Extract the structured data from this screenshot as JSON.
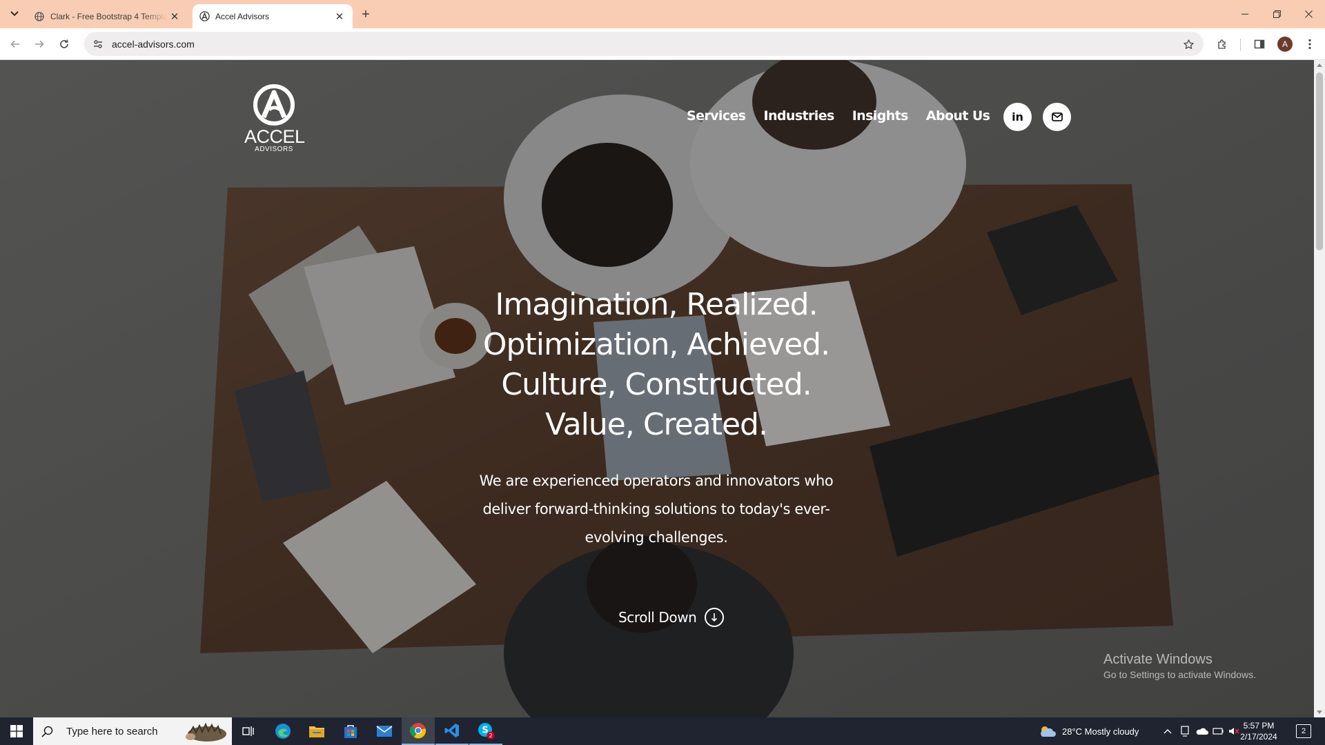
{
  "browser": {
    "tabs": [
      {
        "title": "Clark - Free Bootstrap 4 Template",
        "active": false
      },
      {
        "title": "Accel Advisors",
        "active": true
      }
    ],
    "url": "accel-advisors.com",
    "profile_initial": "A"
  },
  "site": {
    "logo": {
      "word": "ACCEL",
      "sub": "ADVISORS"
    },
    "nav": [
      "Services",
      "Industries",
      "Insights",
      "About Us"
    ],
    "social": {
      "linkedin": "in"
    },
    "headline": [
      "Imagination, Realized.",
      "Optimization, Achieved.",
      "Culture, Constructed.",
      "Value, Created."
    ],
    "lead": "We are experienced operators and innovators who deliver forward-thinking solutions to today's ever-evolving challenges.",
    "scroll_down": "Scroll Down"
  },
  "watermark": {
    "line1": "Activate Windows",
    "line2": "Go to Settings to activate Windows."
  },
  "taskbar": {
    "search_placeholder": "Type here to search",
    "weather": "28°C  Mostly cloudy",
    "time": "5:57 PM",
    "date": "2/17/2024",
    "notification_count": "2",
    "skype_badge": "2"
  },
  "colors": {
    "tabstrip": "#f9cdb3",
    "taskbar": "#1f2430",
    "accent": "#8fb7e8"
  }
}
